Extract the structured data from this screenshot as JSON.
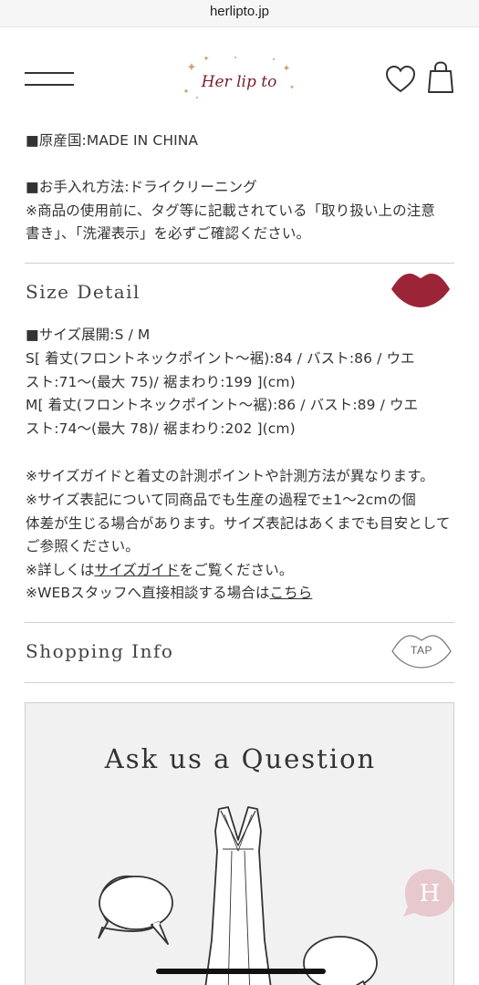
{
  "browser": {
    "url": "herlipto.jp"
  },
  "header": {
    "logo_text": "Her lip to",
    "menu_icon": "hamburger-menu-icon",
    "favorite_icon": "heart-icon",
    "cart_icon": "shopping-bag-icon"
  },
  "details": {
    "origin": "■原産国:MADE IN CHINA",
    "care_title": "■お手入れ方法:ドライクリーニング",
    "care_line1": "※商品の使用前に、タグ等に記載されている「取り扱い上の注意",
    "care_line2": "書き」、「洗濯表示」を必ずご確認ください。"
  },
  "size_detail": {
    "title": "Size Detail",
    "icon": "lips-icon",
    "range": "■サイズ展開:S / M",
    "s_line1": "S[ 着丈(フロントネックポイント〜裾):84 / バスト:86 / ウエ",
    "s_line2": "スト:71〜(最大 75)/ 裾まわり:199 ](cm)",
    "m_line1": "M[ 着丈(フロントネックポイント〜裾):86 / バスト:89 / ウエ",
    "m_line2": "スト:74〜(最大 78)/ 裾まわり:202 ](cm)",
    "note1": "※サイズガイドと着丈の計測ポイントや計測方法が異なります。",
    "note2": "※サイズ表記について同商品でも生産の過程で±1〜2cmの個",
    "note3": "体差が生じる場合があります。サイズ表記はあくまでも目安として",
    "note4": "ご参照ください。",
    "guide_prefix": "※詳しくは",
    "guide_link": "サイズガイド",
    "guide_suffix": "をご覧ください。",
    "staff_prefix": "※WEBスタッフへ直接相談する場合は",
    "staff_link": "こちら"
  },
  "shopping_info": {
    "title": "Shopping Info",
    "tap_label": "TAP"
  },
  "ask": {
    "title": "Ask us a Question"
  },
  "fab": {
    "letter": "H"
  }
}
